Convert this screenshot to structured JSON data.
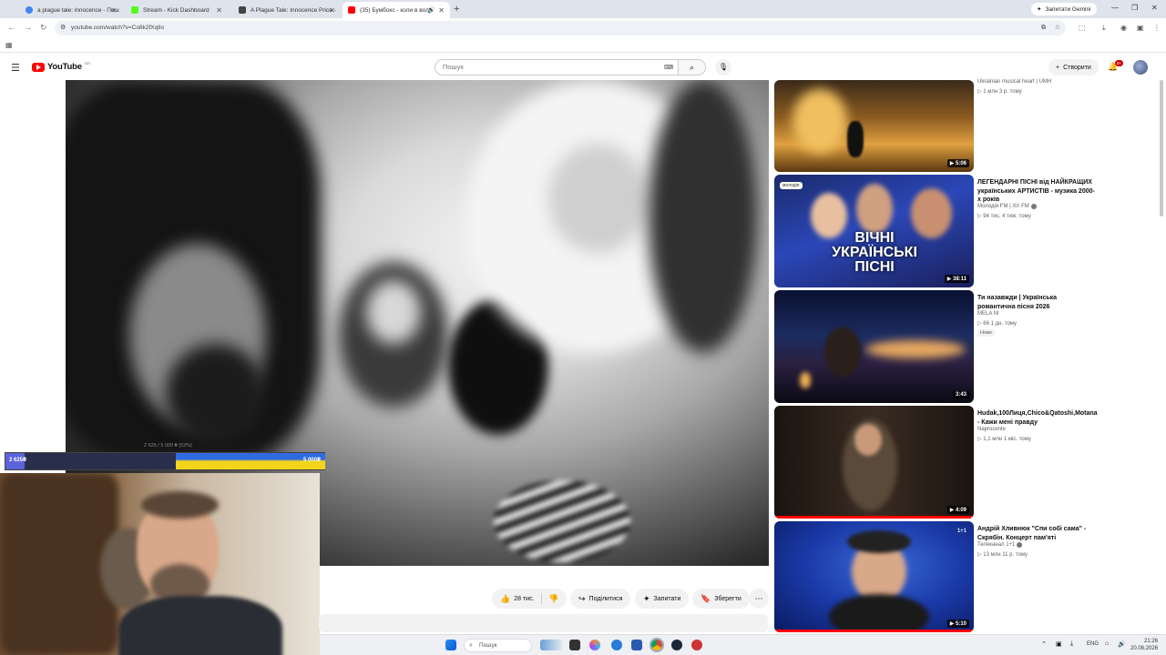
{
  "browser": {
    "tabs": [
      {
        "label": "a plague tale: innocence - Пош",
        "favicon_color": "#4285f4",
        "active": false
      },
      {
        "label": "Stream - Kick Dashboard",
        "favicon_color": "#53fc18",
        "active": false
      },
      {
        "label": "A Plague Tale: Innocence Price -",
        "favicon_color": "#444444",
        "active": false
      },
      {
        "label": "(35) Бумбокс - коли в воло",
        "favicon_color": "#ff0000",
        "active": true
      }
    ],
    "new_tab_icon": "+",
    "gemini_label": "Запитати Gemini",
    "url": "youtube.com/watch?v=Co8k2fXqlIo"
  },
  "youtube": {
    "logo_text": "YouTube",
    "country_code": "UA",
    "search_placeholder": "Пошук",
    "create_label": "Створити",
    "notification_count": "9+"
  },
  "actions": {
    "like_count": "28 тис.",
    "share_label": "Поділитися",
    "ask_label": "Запитати",
    "save_label": "Зберегти"
  },
  "donation": {
    "small_text": "2 625 / 5 000 ₴ (52%)",
    "current": "2 625₴",
    "goal": "5 000₴",
    "progress": 0.52
  },
  "recommendations": [
    {
      "title": "",
      "channel": "Ukrainian musical heart | UMH",
      "meta": "▷ 1 млн  3 р. тому",
      "duration": "▶ 5:06",
      "verified": false,
      "badge": "",
      "progress": 0
    },
    {
      "title": "ЛЕГЕНДАРНІ ПІСНІ від НАЙКРАЩИХ українських АРТИСТІВ - музика 2000-х років",
      "channel": "Молодія FM | Хіт FM",
      "meta": "▷ 94 тис.  4 тиж. тому",
      "duration": "▶ 38:11",
      "verified": true,
      "badge": "",
      "progress": 0,
      "thumb_text": "ВІЧНІ УКРАЇНСЬКІ ПІСНІ",
      "thumb_logo": "молодія"
    },
    {
      "title": "Ти назавжди | Українська романтична пісня 2026",
      "channel": "MELA NI",
      "meta": "▷ 66  1 дн. тому",
      "duration": "3:43",
      "verified": false,
      "badge": "Нове",
      "progress": 0
    },
    {
      "title": "Hudak,100Лиця,Chico&Qatoshi,Motana - Кажи мені правду",
      "channel": "Naprocente",
      "meta": "▷ 1,1 млн  1 міс. тому",
      "duration": "▶ 4:09",
      "verified": false,
      "badge": "",
      "progress": 1.0
    },
    {
      "title": "Андрій Хливнюк \"Спи собі сама\" - Скрябін. Концерт пам'яті",
      "channel": "Телеканал 1+1",
      "meta": "▷ 13 млн  11 р. тому",
      "duration": "▶ 5:10",
      "verified": true,
      "badge": "",
      "progress": 1.0
    }
  ],
  "taskbar": {
    "search_label": "Пошук",
    "language": "ENG",
    "time": "21:26",
    "date": "20.08.2026"
  }
}
